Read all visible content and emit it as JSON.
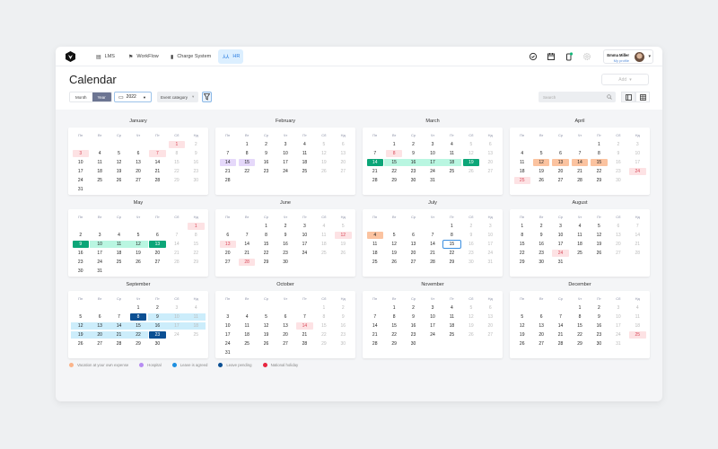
{
  "nav": {
    "items": [
      {
        "label": "LMS",
        "icon": "book-icon"
      },
      {
        "label": "WorkFlow",
        "icon": "flag-icon"
      },
      {
        "label": "Charge System",
        "icon": "battery-icon"
      },
      {
        "label": "HR",
        "icon": "people-icon",
        "active": true
      }
    ],
    "user": {
      "name": "Emma Miller",
      "sub": "My profile"
    }
  },
  "page": {
    "title": "Calendar",
    "add_label": "Add"
  },
  "toolbar": {
    "view_month": "Month",
    "view_year": "Year",
    "year": "2022",
    "event_category": "Event category",
    "search_placeholder": "Search"
  },
  "weekdays": [
    "Пн",
    "Вт",
    "Ср",
    "Чт",
    "Пт",
    "Сб",
    "Нд"
  ],
  "months": [
    {
      "name": "January",
      "offset": 5,
      "days": 31,
      "marks": {
        "1": "holiday",
        "3": "holiday",
        "7": "holiday"
      }
    },
    {
      "name": "February",
      "offset": 1,
      "days": 28,
      "marks": {
        "14": "hospital",
        "15": "hospital"
      }
    },
    {
      "name": "March",
      "offset": 1,
      "days": 31,
      "marks": {
        "8": "holiday",
        "14": "gend",
        "15": "gmid",
        "16": "gmid",
        "17": "gmid",
        "18": "gmid",
        "19": "gend"
      }
    },
    {
      "name": "April",
      "offset": 4,
      "days": 30,
      "marks": {
        "12": "vacation",
        "13": "vacation",
        "14": "vacation",
        "15": "vacation",
        "24": "holiday",
        "25": "holiday"
      }
    },
    {
      "name": "May",
      "offset": 6,
      "days": 31,
      "marks": {
        "1": "holiday",
        "9": "gend",
        "10": "gmid",
        "11": "gmid",
        "12": "gmid",
        "13": "gend"
      }
    },
    {
      "name": "June",
      "offset": 2,
      "days": 30,
      "marks": {
        "12": "holiday",
        "13": "holiday",
        "28": "holiday"
      }
    },
    {
      "name": "July",
      "offset": 4,
      "days": 31,
      "marks": {
        "4": "vacation",
        "15": "today"
      }
    },
    {
      "name": "August",
      "offset": 0,
      "days": 31,
      "marks": {
        "24": "holiday"
      }
    },
    {
      "name": "September",
      "offset": 3,
      "days": 30,
      "marks": {
        "8": "bend",
        "9": "bmid",
        "10": "bmid",
        "11": "bmid",
        "12": "bmid",
        "13": "bmid",
        "14": "bmid",
        "15": "bmid",
        "16": "bmid",
        "17": "bmid",
        "18": "bmid",
        "19": "bmid",
        "20": "bmid",
        "21": "bmid",
        "22": "bmid",
        "23": "bend"
      }
    },
    {
      "name": "October",
      "offset": 5,
      "days": 31,
      "marks": {
        "14": "holiday"
      }
    },
    {
      "name": "November",
      "offset": 1,
      "days": 30,
      "marks": {}
    },
    {
      "name": "December",
      "offset": 3,
      "days": 31,
      "marks": {
        "25": "holiday"
      }
    }
  ],
  "legend": [
    {
      "label": "Vacation at your own expense",
      "color": "#fbb48a"
    },
    {
      "label": "Hospital",
      "color": "#b68cf2"
    },
    {
      "label": "Leave is agreed",
      "color": "#1d8fe0"
    },
    {
      "label": "Leave pending",
      "color": "#0b4f93"
    },
    {
      "label": "National holiday",
      "color": "#e8253f"
    }
  ]
}
